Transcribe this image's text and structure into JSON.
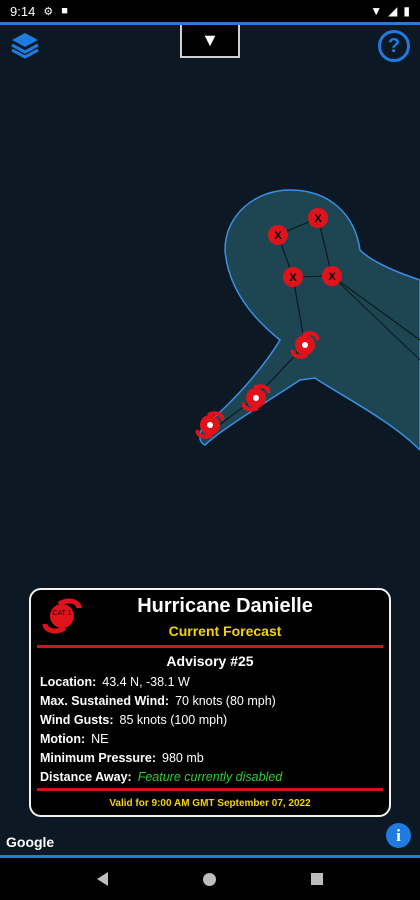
{
  "status_bar": {
    "time": "9:14",
    "left_icons": [
      "settings-icon",
      "notification-icon"
    ],
    "right_icons": [
      "wifi-icon",
      "signal-icon",
      "battery-icon"
    ]
  },
  "map": {
    "dropdown_glyph": "▼",
    "attribution": "Google",
    "colors": {
      "cone_fill": "#1e4652",
      "cone_stroke": "#3a8fe6",
      "hurricane_red": "#e0131d"
    },
    "forecast_points": [
      {
        "type": "hurricane",
        "label": ""
      },
      {
        "type": "hurricane",
        "label": ""
      },
      {
        "type": "hurricane",
        "label": ""
      },
      {
        "type": "extratropical",
        "label": "X"
      },
      {
        "type": "extratropical",
        "label": "X"
      },
      {
        "type": "extratropical",
        "label": "X"
      },
      {
        "type": "extratropical",
        "label": "X"
      }
    ]
  },
  "card": {
    "logo_text": "CAT 1",
    "title": "Hurricane Danielle",
    "subtitle": "Current Forecast",
    "advisory": "Advisory #25",
    "rows": [
      {
        "label": "Location:",
        "value": "43.4 N, -38.1 W"
      },
      {
        "label": "Max. Sustained Wind:",
        "value": "70 knots (80 mph)"
      },
      {
        "label": "Wind Gusts:",
        "value": "85 knots (100 mph)"
      },
      {
        "label": "Motion:",
        "value": "NE"
      },
      {
        "label": "Minimum Pressure:",
        "value": "980 mb"
      },
      {
        "label": "Distance Away:",
        "value": "Feature currently disabled"
      }
    ],
    "valid_text": "Valid for 9:00 AM GMT September 07, 2022"
  },
  "help_glyph": "?",
  "info_glyph": "i"
}
